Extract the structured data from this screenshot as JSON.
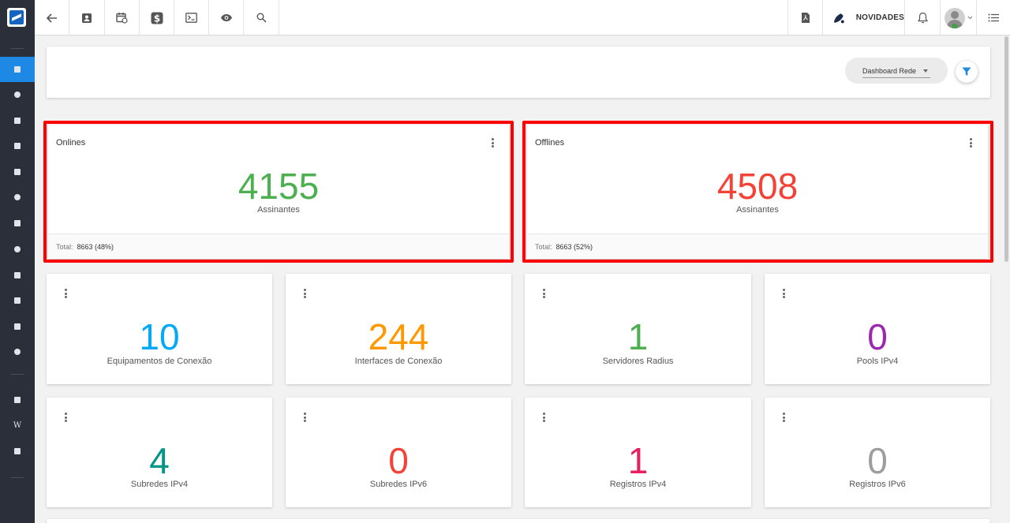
{
  "topbar": {
    "novidades_label": "NOVIDADES"
  },
  "filter": {
    "dashboard_select": "Dashboard Rede"
  },
  "cards_top": [
    {
      "title": "Onlines",
      "value": "4155",
      "label": "Assinantes",
      "footer_label": "Total:",
      "footer_value": "8663 (48%)",
      "color": "#4caf50"
    },
    {
      "title": "Offlines",
      "value": "4508",
      "label": "Assinantes",
      "footer_label": "Total:",
      "footer_value": "8663 (52%)",
      "color": "#f44336"
    }
  ],
  "cards_grid": [
    {
      "value": "10",
      "label": "Equipamentos de Conexão",
      "color": "#03a9f4"
    },
    {
      "value": "244",
      "label": "Interfaces de Conexão",
      "color": "#ff9800"
    },
    {
      "value": "1",
      "label": "Servidores Radius",
      "color": "#4caf50"
    },
    {
      "value": "0",
      "label": "Pools IPv4",
      "color": "#9c27b0"
    },
    {
      "value": "4",
      "label": "Subredes IPv4",
      "color": "#009688"
    },
    {
      "value": "0",
      "label": "Subredes IPv6",
      "color": "#f44336"
    },
    {
      "value": "1",
      "label": "Registros IPv4",
      "color": "#e91e63"
    },
    {
      "value": "0",
      "label": "Registros IPv6",
      "color": "#9e9e9e"
    }
  ],
  "colors": {
    "sidebar_bg": "#2b2f3a",
    "sidebar_active": "#1e88e5",
    "highlight_border": "#ff0000",
    "filter_icon": "#1e88e5"
  }
}
